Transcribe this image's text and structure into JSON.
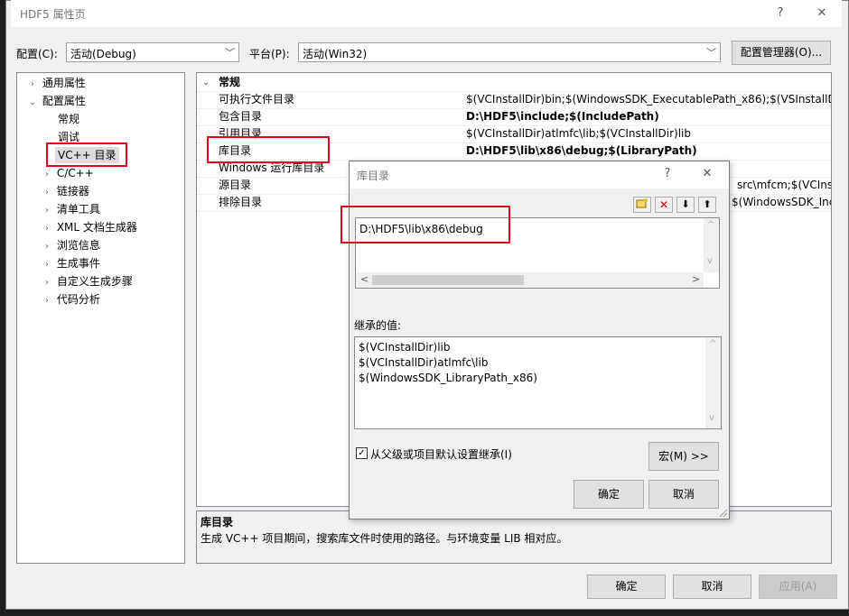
{
  "window": {
    "title": "HDF5 属性页",
    "help_glyph": "?",
    "close_glyph": "✕"
  },
  "toolbar": {
    "config_label": "配置(C):",
    "config_value": "活动(Debug)",
    "platform_label": "平台(P):",
    "platform_value": "活动(Win32)",
    "config_manager": "配置管理器(O)..."
  },
  "tree": {
    "items": [
      {
        "label": "通用属性",
        "arrow": "›"
      },
      {
        "label": "配置属性",
        "arrow": "⌄"
      },
      {
        "label": "常规",
        "arrow": ""
      },
      {
        "label": "调试",
        "arrow": ""
      },
      {
        "label": "VC++ 目录",
        "arrow": ""
      },
      {
        "label": "C/C++",
        "arrow": "›"
      },
      {
        "label": "链接器",
        "arrow": "›"
      },
      {
        "label": "清单工具",
        "arrow": "›"
      },
      {
        "label": "XML 文档生成器",
        "arrow": "›"
      },
      {
        "label": "浏览信息",
        "arrow": "›"
      },
      {
        "label": "生成事件",
        "arrow": "›"
      },
      {
        "label": "自定义生成步骤",
        "arrow": "›"
      },
      {
        "label": "代码分析",
        "arrow": "›"
      }
    ]
  },
  "grid": {
    "section": "常规",
    "section_arrow": "⌄",
    "rows": [
      {
        "name": "可执行文件目录",
        "value": "$(VCInstallDir)bin;$(WindowsSDK_ExecutablePath_x86);$(VSInstallDir)C",
        "bold": false
      },
      {
        "name": "包含目录",
        "value": "D:\\HDF5\\include;$(IncludePath)",
        "bold": true
      },
      {
        "name": "引用目录",
        "value": "$(VCInstallDir)atlmfc\\lib;$(VCInstallDir)lib",
        "bold": false
      },
      {
        "name": "库目录",
        "value": "D:\\HDF5\\lib\\x86\\debug;$(LibraryPath)",
        "bold": true
      },
      {
        "name": "Windows 运行库目录",
        "value": "",
        "bold": false
      },
      {
        "name": "源目录",
        "value": "src\\mfcm;$(VCInstal",
        "bold": false
      },
      {
        "name": "排除目录",
        "value": "$(WindowsSDK_Incl",
        "bold": false
      }
    ]
  },
  "description": {
    "title": "库目录",
    "text": "生成 VC++ 项目期间，搜索库文件时使用的路径。与环境变量 LIB 相对应。"
  },
  "footer": {
    "ok": "确定",
    "cancel": "取消",
    "apply": "应用(A)"
  },
  "dialog": {
    "title": "库目录",
    "help_glyph": "?",
    "close_glyph": "✕",
    "toolbar": {
      "new_line": "▫",
      "delete": "✕",
      "move_down": "⬇",
      "move_up": "⬆"
    },
    "edit_value": "D:\\HDF5\\lib\\x86\\debug",
    "scroll_up": "^",
    "scroll_down": "v",
    "scroll_left": "<",
    "scroll_right": ">",
    "inherited_label": "继承的值:",
    "inherited": [
      "$(VCInstallDir)lib",
      "$(VCInstallDir)atlmfc\\lib",
      "$(WindowsSDK_LibraryPath_x86)"
    ],
    "inherit_checkbox": "从父级或项目默认设置继承(I)",
    "inherit_checked": "✓",
    "macro_button": "宏(M) >>",
    "ok": "确定",
    "cancel": "取消"
  },
  "colors": {
    "highlight_border": "#e0001b",
    "window_bg": "#f0f0f0",
    "editor_bg": "#1e1e1e"
  }
}
